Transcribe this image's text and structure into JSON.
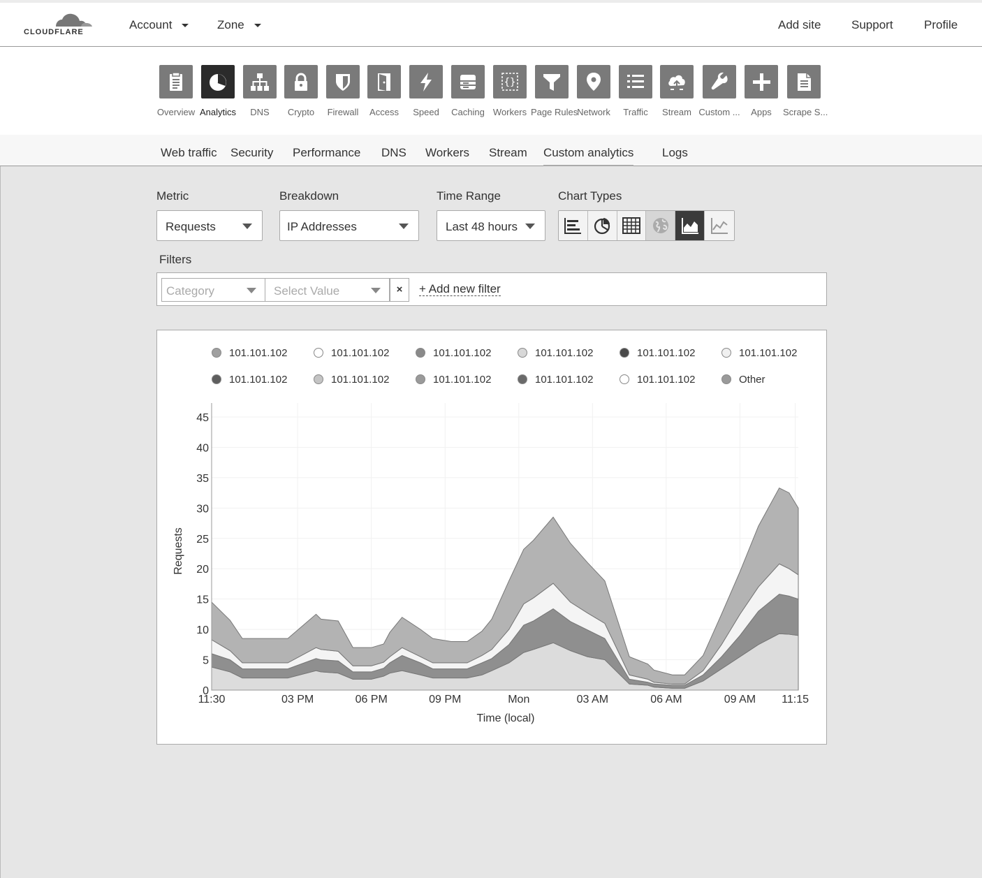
{
  "header": {
    "logo_text": "CLOUDFLARE",
    "account_label": "Account",
    "zone_label": "Zone",
    "add_site_label": "Add site",
    "support_label": "Support",
    "profile_label": "Profile"
  },
  "apps": [
    {
      "label": "Overview",
      "icon": "clipboard-icon"
    },
    {
      "label": "Analytics",
      "icon": "pie-chart-icon",
      "active": true
    },
    {
      "label": "DNS",
      "icon": "sitemap-icon"
    },
    {
      "label": "Crypto",
      "icon": "lock-icon"
    },
    {
      "label": "Firewall",
      "icon": "shield-icon"
    },
    {
      "label": "Access",
      "icon": "door-icon"
    },
    {
      "label": "Speed",
      "icon": "lightning-icon"
    },
    {
      "label": "Caching",
      "icon": "server-icon"
    },
    {
      "label": "Workers",
      "icon": "braces-icon"
    },
    {
      "label": "Page Rules",
      "icon": "filter-icon"
    },
    {
      "label": "Network",
      "icon": "map-pin-icon"
    },
    {
      "label": "Traffic",
      "icon": "list-icon"
    },
    {
      "label": "Stream",
      "icon": "cloud-upload-icon"
    },
    {
      "label": "Custom ...",
      "icon": "wrench-icon"
    },
    {
      "label": "Apps",
      "icon": "plus-icon"
    },
    {
      "label": "Scrape S...",
      "icon": "document-icon"
    }
  ],
  "subnav": [
    "Web traffic",
    "Security",
    "Performance",
    "DNS",
    "Workers",
    "Stream",
    "Custom analytics",
    "Logs"
  ],
  "subnav_active": "Custom analytics",
  "controls": {
    "metric_label": "Metric",
    "metric_value": "Requests",
    "breakdown_label": "Breakdown",
    "breakdown_value": "IP Addresses",
    "timerange_label": "Time Range",
    "timerange_value": "Last 48 hours",
    "charttypes_label": "Chart Types",
    "chart_types": [
      "bar-chart-icon",
      "pie-chart-icon",
      "table-icon",
      "globe-icon",
      "area-chart-icon",
      "line-chart-icon"
    ],
    "chart_type_active": "area-chart-icon"
  },
  "filters": {
    "label": "Filters",
    "category_placeholder": "Category",
    "value_placeholder": "Select Value",
    "clear_label": "×",
    "add_label": "+ Add new filter"
  },
  "legend": [
    {
      "label": "101.101.102",
      "color": "#a0a0a0"
    },
    {
      "label": "101.101.102",
      "color": "#ffffff"
    },
    {
      "label": "101.101.102",
      "color": "#8a8a8a"
    },
    {
      "label": "101.101.102",
      "color": "#d8d8d8"
    },
    {
      "label": "101.101.102",
      "color": "#4a4a4a"
    },
    {
      "label": "101.101.102",
      "color": "#f0f0f0"
    },
    {
      "label": "101.101.102",
      "color": "#5e5e5e"
    },
    {
      "label": "101.101.102",
      "color": "#c4c4c4"
    },
    {
      "label": "101.101.102",
      "color": "#9a9a9a"
    },
    {
      "label": "101.101.102",
      "color": "#6a6a6a"
    },
    {
      "label": "101.101.102",
      "color": "#ffffff"
    },
    {
      "label": "Other",
      "color": "#9a9a9a"
    }
  ],
  "chart_data": {
    "type": "area",
    "stacked": true,
    "xlabel": "Time (local)",
    "ylabel": "Requests",
    "ylim": [
      0,
      45
    ],
    "yticks": [
      0,
      5,
      10,
      15,
      20,
      25,
      30,
      35,
      40,
      45
    ],
    "x_range_hours": [
      0,
      47.75
    ],
    "xticks": [
      {
        "t": 0,
        "label": "11:30"
      },
      {
        "t": 3.5,
        "label": "03 PM"
      },
      {
        "t": 6.5,
        "label": "06 PM"
      },
      {
        "t": 9.5,
        "label": "09 PM"
      },
      {
        "t": 12.5,
        "label": "Mon"
      },
      {
        "t": 15.5,
        "label": "03 AM"
      },
      {
        "t": 18.5,
        "label": "06 AM"
      },
      {
        "t": 21.5,
        "label": "09 AM"
      },
      {
        "t": 23.75,
        "label": "11:15"
      }
    ],
    "x_hours": [
      0,
      1.5,
      2.5,
      4,
      5.5,
      6.2,
      8.5,
      8.9,
      10.3,
      11.5,
      13,
      14,
      14.5,
      15.5,
      17,
      18,
      19.5,
      20.8,
      22,
      22.8,
      24.2,
      25.4,
      26.2,
      27.8,
      29.2,
      30.6,
      32,
      34,
      35.5,
      36,
      37.5,
      38.5,
      40,
      41.5,
      43,
      44.5,
      46.2,
      47,
      47.75
    ],
    "series": [
      {
        "color": "#dcdcdc",
        "values": [
          3.8,
          3,
          2,
          2,
          2,
          2,
          3.2,
          3,
          2.8,
          1.8,
          1.8,
          2.3,
          2.8,
          3.2,
          2.5,
          2,
          2,
          2,
          2.5,
          3.2,
          4.5,
          6.2,
          6.7,
          7.8,
          6.5,
          5.5,
          5,
          1,
          0.8,
          0.5,
          0.3,
          0.3,
          1.5,
          3.5,
          5.5,
          7.5,
          9.3,
          9.2,
          9
        ]
      },
      {
        "color": "#8f8f8f",
        "values": [
          2.2,
          2,
          1.5,
          1.5,
          1.5,
          1.5,
          2,
          2,
          2,
          1.2,
          1.2,
          1.3,
          1.7,
          2.5,
          2,
          1.5,
          1.5,
          1.5,
          2,
          2,
          3,
          4.5,
          4.7,
          5.6,
          4.8,
          4.4,
          3.5,
          0.8,
          0.5,
          0.5,
          0.5,
          0.5,
          1,
          2,
          3.5,
          5.5,
          6.5,
          6.3,
          6
        ]
      },
      {
        "color": "#f4f4f4",
        "values": [
          2.3,
          1.5,
          1,
          1,
          1,
          1,
          1.8,
          1.7,
          1.6,
          1,
          1,
          1,
          1,
          1.3,
          1,
          1,
          1,
          1,
          1.2,
          1.5,
          2.5,
          3.5,
          3.8,
          4.2,
          3.2,
          2.8,
          2.5,
          0.7,
          0.5,
          0.3,
          0.2,
          0.2,
          0.7,
          2,
          3.5,
          4,
          5,
          4.5,
          4
        ]
      },
      {
        "color": "#b3b3b3",
        "values": [
          6.2,
          5,
          4,
          4,
          4,
          4,
          5.5,
          5,
          5,
          3,
          3,
          3,
          4,
          5,
          4.5,
          4,
          3.5,
          3.5,
          4,
          5,
          8,
          9,
          9.5,
          10.9,
          9.7,
          8.3,
          7,
          3,
          2.5,
          2,
          1.5,
          1.5,
          2.5,
          5,
          7,
          10,
          12.5,
          12.5,
          11
        ]
      }
    ]
  }
}
